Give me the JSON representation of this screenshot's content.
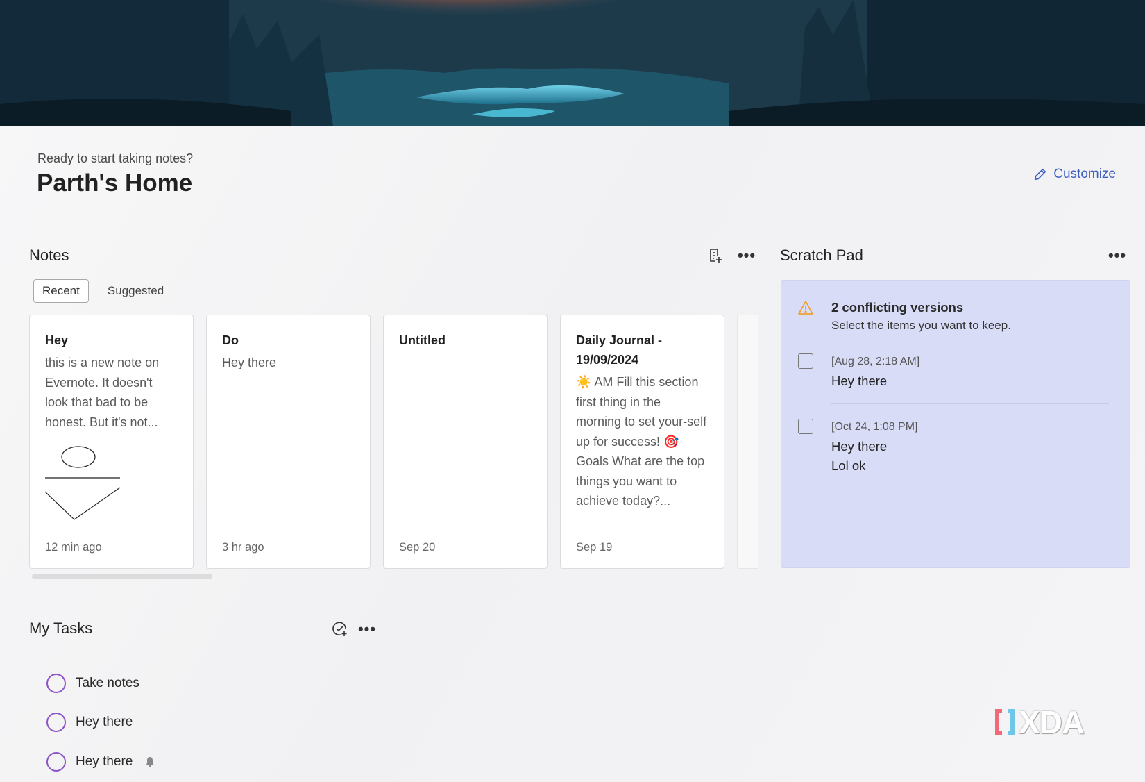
{
  "header": {
    "greeting": "Ready to start taking notes?",
    "title": "Parth's Home",
    "customize_label": "Customize"
  },
  "notes": {
    "title": "Notes",
    "tabs": [
      {
        "label": "Recent",
        "active": true
      },
      {
        "label": "Suggested",
        "active": false
      }
    ],
    "cards": [
      {
        "title": "Hey",
        "body": "this is a new note on Evernote. It doesn't look that bad to be honest. But it's not...",
        "date": "12 min ago",
        "has_sketch": true
      },
      {
        "title": "Do",
        "body": "Hey there",
        "date": "3 hr ago"
      },
      {
        "title": "Untitled",
        "body": "",
        "date": "Sep 20"
      },
      {
        "title": "Daily Journal - 19/09/2024",
        "body": "☀️ AM Fill this section first thing in the morning to set your-self up for success! 🎯 Goals What are the top things you want to achieve today?...",
        "date": "Sep 19"
      }
    ]
  },
  "scratch_pad": {
    "title": "Scratch Pad",
    "conflict_title": "2 conflicting versions",
    "conflict_subtitle": "Select the items you want to keep.",
    "versions": [
      {
        "time": "[Aug 28, 2:18 AM]",
        "lines": [
          "Hey there"
        ]
      },
      {
        "time": "[Oct 24, 1:08 PM]",
        "lines": [
          "Hey there",
          "Lol ok"
        ]
      }
    ],
    "background_color": "#d9dcf7"
  },
  "tasks": {
    "title": "My Tasks",
    "items": [
      {
        "label": "Take notes",
        "reminder": false
      },
      {
        "label": "Hey there",
        "reminder": false
      },
      {
        "label": "Hey there",
        "reminder": true
      }
    ]
  },
  "more_icon": "•••",
  "watermark": "XDA",
  "colors": {
    "accent": "#3d5fc4",
    "task_circle": "#8b53c7",
    "warning": "#f0a030"
  }
}
